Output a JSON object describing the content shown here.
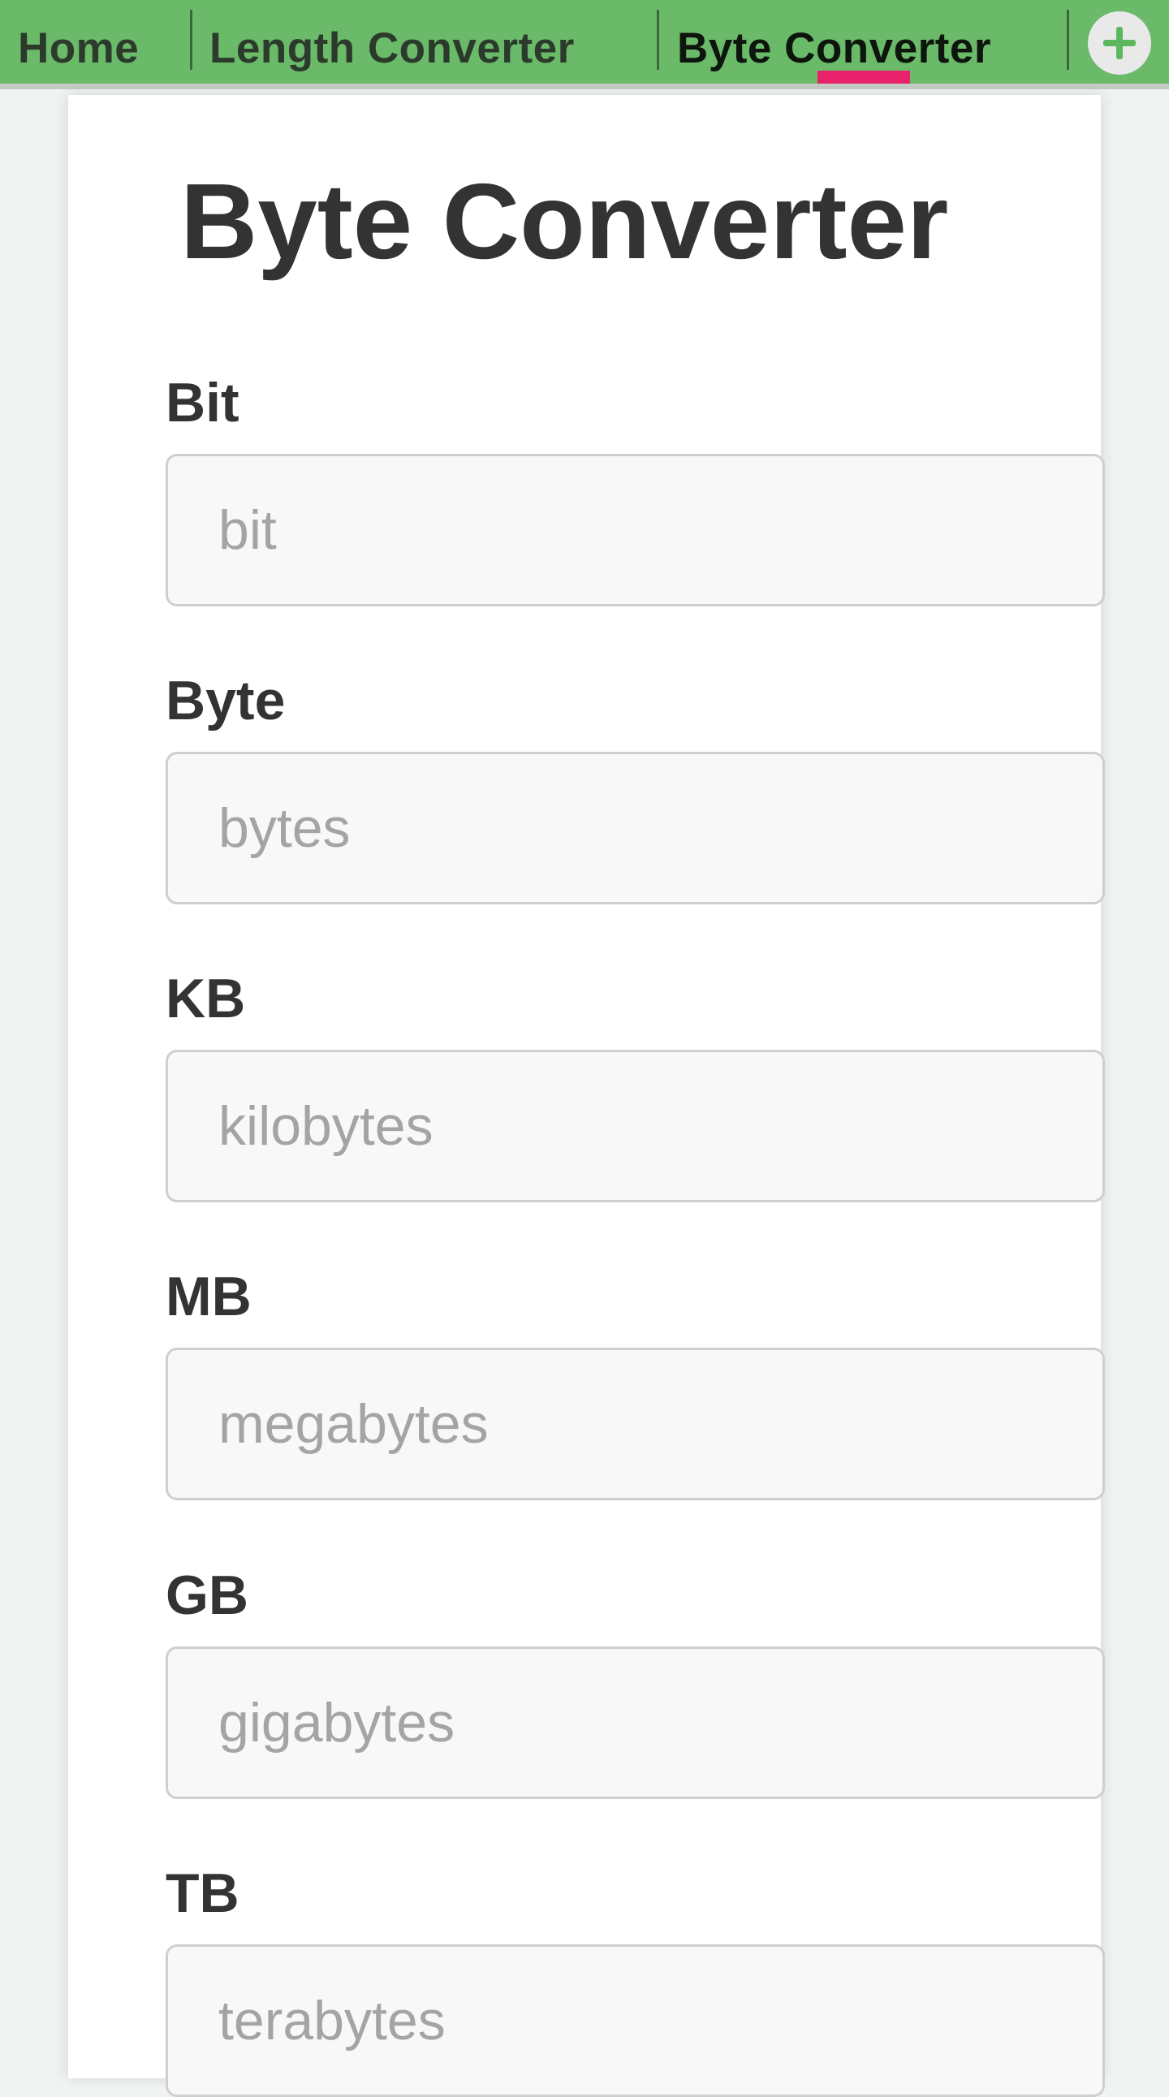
{
  "tabs": [
    {
      "label": "Home",
      "active": false
    },
    {
      "label": "Length Converter",
      "active": false
    },
    {
      "label": "Byte Converter",
      "active": true
    }
  ],
  "add_tab_icon": "plus-icon",
  "page": {
    "title": "Byte Converter"
  },
  "fields": [
    {
      "label": "Bit",
      "placeholder": "bit",
      "value": ""
    },
    {
      "label": "Byte",
      "placeholder": "bytes",
      "value": ""
    },
    {
      "label": "KB",
      "placeholder": "kilobytes",
      "value": ""
    },
    {
      "label": "MB",
      "placeholder": "megabytes",
      "value": ""
    },
    {
      "label": "GB",
      "placeholder": "gigabytes",
      "value": ""
    },
    {
      "label": "TB",
      "placeholder": "terabytes",
      "value": ""
    }
  ],
  "colors": {
    "tabbar_bg": "#6aba6a",
    "active_indicator": "#e8226a",
    "text": "#333333",
    "placeholder": "#a4a4a4"
  }
}
